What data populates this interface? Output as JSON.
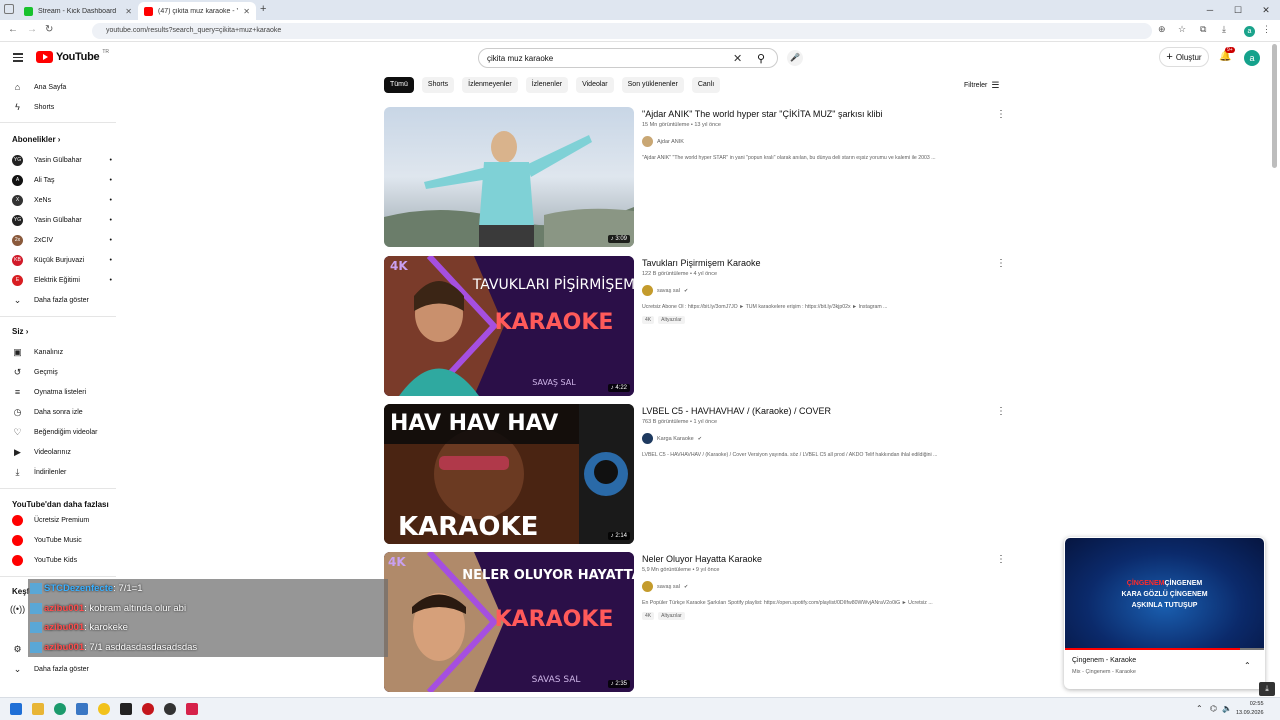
{
  "browser": {
    "tabs": [
      {
        "title": "Stream - Kick Dashboard",
        "favicon_color": "#19c22d"
      },
      {
        "title": "(47) çikita muz karaoke - YouTube",
        "favicon_color": "#ff0000"
      }
    ],
    "url": "youtube.com/results?search_query=çikita+muz+karaoke",
    "profile_letter": "a"
  },
  "header": {
    "logo_text": "YouTube",
    "logo_sup": "TR",
    "search_value": "çikita muz karaoke",
    "create_label": "Oluştur",
    "notif_count": "9+",
    "avatar_letter": "a"
  },
  "sidebar": {
    "main": [
      {
        "label": "Ana Sayfa",
        "icon": "home-icon",
        "glyph": "⌂"
      },
      {
        "label": "Shorts",
        "icon": "shorts-icon",
        "glyph": "ϟ"
      }
    ],
    "subs_title": "Abonelikler",
    "subscriptions": [
      {
        "label": "Yasin Gülbahar",
        "color": "#222"
      },
      {
        "label": "Ali Taş",
        "color": "#111"
      },
      {
        "label": "XeNs",
        "color": "#333"
      },
      {
        "label": "Yasin Gülbahar",
        "color": "#222"
      },
      {
        "label": "2xCIV",
        "color": "#8a5a3c"
      },
      {
        "label": "Küçük Burjuvazi",
        "color": "#d11b2a"
      },
      {
        "label": "Elektrik Eğitimi",
        "color": "#d81e22"
      }
    ],
    "show_more": "Daha fazla göster",
    "you_title": "Siz",
    "you_items": [
      {
        "label": "Kanalınız",
        "icon": "channel-icon",
        "glyph": "▣"
      },
      {
        "label": "Geçmiş",
        "icon": "history-icon",
        "glyph": "↺"
      },
      {
        "label": "Oynatma listeleri",
        "icon": "playlists-icon",
        "glyph": "≡"
      },
      {
        "label": "Daha sonra izle",
        "icon": "watch-later-icon",
        "glyph": "◷"
      },
      {
        "label": "Beğendiğim videolar",
        "icon": "like-icon",
        "glyph": "👍"
      },
      {
        "label": "Videolarınız",
        "icon": "your-videos-icon",
        "glyph": "▶"
      },
      {
        "label": "İndirilenler",
        "icon": "downloads-icon",
        "glyph": "⤓"
      }
    ],
    "more_title": "YouTube'dan daha fazlası",
    "more_items": [
      {
        "label": "Ücretsiz Premium",
        "color": "#ff0000"
      },
      {
        "label": "YouTube Music",
        "color": "#ff0000"
      },
      {
        "label": "YouTube Kids",
        "color": "#ff0000"
      }
    ],
    "explore_title": "Keşfet",
    "bottom_more": "Daha fazla göster"
  },
  "chips": [
    "Tümü",
    "Shorts",
    "İzlenmeyenler",
    "İzlenenler",
    "Videolar",
    "Son yüklenenler",
    "Canlı"
  ],
  "filters_label": "Filtreler",
  "results": [
    {
      "title": "\"Ajdar ANIK\" The world hyper star \"ÇİKİTA MUZ\" şarkısı klibi",
      "stats": "15 Mn görüntüleme • 13 yıl önce",
      "channel": "Ajdar ANIK",
      "verified": false,
      "desc": "\"Ajdar ANIK\" \"The world hyper STAR\" in yani \"popun kralı\" olarak anılan, bu dünya deli starın eşsiz yorumu ve kalemi ile 2003 ...",
      "badges": [],
      "duration": "3:09"
    },
    {
      "title": "Tavukları Pişirmişem Karaoke",
      "stats": "122 B görüntüleme • 4 yıl önce",
      "channel": "savaş sal",
      "verified": true,
      "desc": "Ücretsiz Abone Ol : https://bit.ly/3omJ7JO ► TÜM karaokelere erişim : https://bit.ly/3kjp02x ► Instagram ...",
      "badges": [
        "4K",
        "Altyazılar"
      ],
      "duration": "4:22"
    },
    {
      "title": "LVBEL C5 - HAVHAVHAV / (Karaoke) / COVER",
      "stats": "763 B görüntüleme • 1 yıl önce",
      "channel": "Karga Karaoke",
      "verified": true,
      "desc": "LVBEL C5 - HAVHAVHAV / (Karaoke) / Cover Versiyon yayında. söz / LVBEL C5 all prod / AKDO Telif hakkından ihlal edildiğini ...",
      "badges": [],
      "duration": "2:14"
    },
    {
      "title": "Neler Oluyor Hayatta Karaoke",
      "stats": "5,9 Mn görüntüleme • 9 yıl önce",
      "channel": "savaş sal",
      "verified": true,
      "desc": "En Popüler Türkçe Karaoke Şarkıları Spotify playlist: https://open.spotify.com/playlist/0DIIfw80WWvjANraV2o0iG ► Ücretsiz ...",
      "badges": [
        "4K",
        "Altyazılar"
      ],
      "duration": "2:35"
    }
  ],
  "thumbs": {
    "t2_top": "TAVUKLARI PİŞİRMİŞEM",
    "karaoke": "KARAOKE",
    "t2_brand": "SAVAŞ SAL",
    "t3_top": "HAV HAV HAV",
    "t4_top": "NELER OLUYOR HAYATTA",
    "t4_brand": "SAVAS SAL",
    "fourk": "4K"
  },
  "mini_player": {
    "lyric_red_1": "ÇİNGENEM",
    "lyric_white_1": "ÇİNGENEM",
    "lyric_2": "KARA GÖZLÜ ÇİNGENEM",
    "lyric_3": "AŞKINLA TUTUŞUP",
    "title": "Çingenem - Karaoke",
    "subtitle": "Mix - Çingenem - Karaoke",
    "progress": 0.88
  },
  "chat": [
    {
      "nick": "STCDezenfecte",
      "msg": " : 7/1=1",
      "nick_color": "blue"
    },
    {
      "nick": "azibu001",
      "msg": " : kobram altında olur abi",
      "nick_color": "red"
    },
    {
      "nick": "azibu001",
      "msg": " : karokeke",
      "nick_color": "red"
    },
    {
      "nick": "azibu001",
      "msg": " : 7/1 asddasdasdasadsdas",
      "nick_color": "red"
    }
  ],
  "taskbar": {
    "time": "02:55",
    "date": "13.09.2026"
  }
}
